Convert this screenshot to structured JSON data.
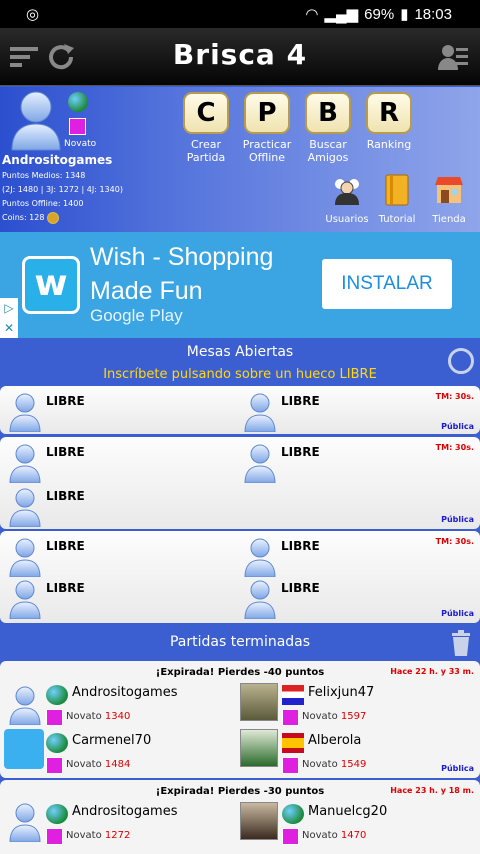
{
  "status": {
    "battery": "69%",
    "time": "18:03"
  },
  "title": "Brisca 4",
  "profile": {
    "rank": "Novato",
    "username": "Andrositogames",
    "stats_line1": "Puntos Medios: 1348",
    "stats_line2": "(2J: 1480 | 3J: 1272 | 4J: 1340)",
    "stats_line3": "Puntos Offline: 1400",
    "coins": "Coins: 128"
  },
  "menu": [
    {
      "key": "C",
      "label1": "Crear",
      "label2": "Partida"
    },
    {
      "key": "P",
      "label1": "Practicar",
      "label2": "Offline"
    },
    {
      "key": "B",
      "label1": "Buscar",
      "label2": "Amigos"
    },
    {
      "key": "R",
      "label1": "Ranking",
      "label2": ""
    }
  ],
  "icons_row": [
    {
      "label": "Usuarios"
    },
    {
      "label": "Tutorial"
    },
    {
      "label": "Tienda"
    }
  ],
  "ad": {
    "headline": "Wish - Shopping Made Fun",
    "store": "Google Play",
    "install": "INSTALAR"
  },
  "mesas": {
    "title": "Mesas Abiertas",
    "subtitle": "Inscríbete pulsando sobre un hueco LIBRE",
    "slot_label": "LIBRE",
    "tm": "TM: 30s.",
    "public": "Pública"
  },
  "terminadas": {
    "title": "Partidas terminadas",
    "games": [
      {
        "header": "¡Expirada! Pierdes -40 puntos",
        "ago": "Hace 22 h. y 33 m.",
        "players": [
          {
            "name": "Andrositogames",
            "rank": "Novato",
            "score": "1340"
          },
          {
            "name": "Felixjun47",
            "rank": "Novato",
            "score": "1597"
          },
          {
            "name": "Carmenel70",
            "rank": "Novato",
            "score": "1484"
          },
          {
            "name": "Alberola",
            "rank": "Novato",
            "score": "1549"
          }
        ],
        "public": "Pública"
      },
      {
        "header": "¡Expirada! Pierdes -30 puntos",
        "ago": "Hace 23 h. y 18 m.",
        "players": [
          {
            "name": "Andrositogames",
            "rank": "Novato",
            "score": "1272"
          },
          {
            "name": "Manuelcg20",
            "rank": "Novato",
            "score": "1470"
          }
        ]
      }
    ]
  },
  "colors": {
    "accent_red": "#dd0000",
    "yellow": "#ffd814",
    "blue_bg": "#3b5fd0",
    "magenta": "#e020e0"
  }
}
